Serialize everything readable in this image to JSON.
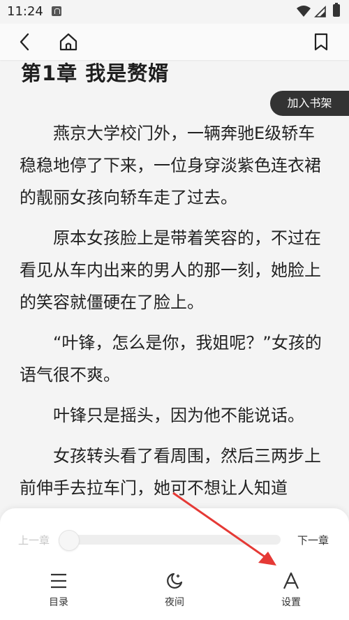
{
  "status_bar": {
    "time": "11:24",
    "icons": [
      "notification-icon",
      "wifi-icon",
      "signal-icon",
      "battery-icon"
    ]
  },
  "nav": {
    "icons": [
      "back-arrow-icon",
      "home-icon",
      "bookmark-icon"
    ]
  },
  "chapter": {
    "title": "第1章 我是赘婿",
    "paragraphs": [
      "燕京大学校门外，一辆奔驰E级轿车稳稳地停了下来，一位身穿淡紫色连衣裙的靓丽女孩向轿车走了过去。",
      "原本女孩脸上是带着笑容的，不过在看见从车内出来的男人的那一刻，她脸上的笑容就僵硬在了脸上。",
      "“叶锋，怎么是你，我姐呢？”女孩的语气很不爽。",
      "叶锋只是摇头，因为他不能说话。",
      "女孩转头看了看周围，然后三两步上前伸手去拉车门，她可不想让人知道"
    ]
  },
  "add_to_shelf": "加入书架",
  "reader_panel": {
    "prev_chapter": "上一章",
    "next_chapter": "下一章",
    "progress_fraction": 0.0,
    "tabs": [
      {
        "label": "目录",
        "icon": "menu-lines-icon"
      },
      {
        "label": "夜间",
        "icon": "moon-icon"
      },
      {
        "label": "设置",
        "icon": "font-settings-icon"
      }
    ]
  },
  "colors": {
    "background": "#f4f4f4",
    "text": "#222222",
    "shelf_button": "#333333",
    "annotation_arrow": "#e53935"
  }
}
